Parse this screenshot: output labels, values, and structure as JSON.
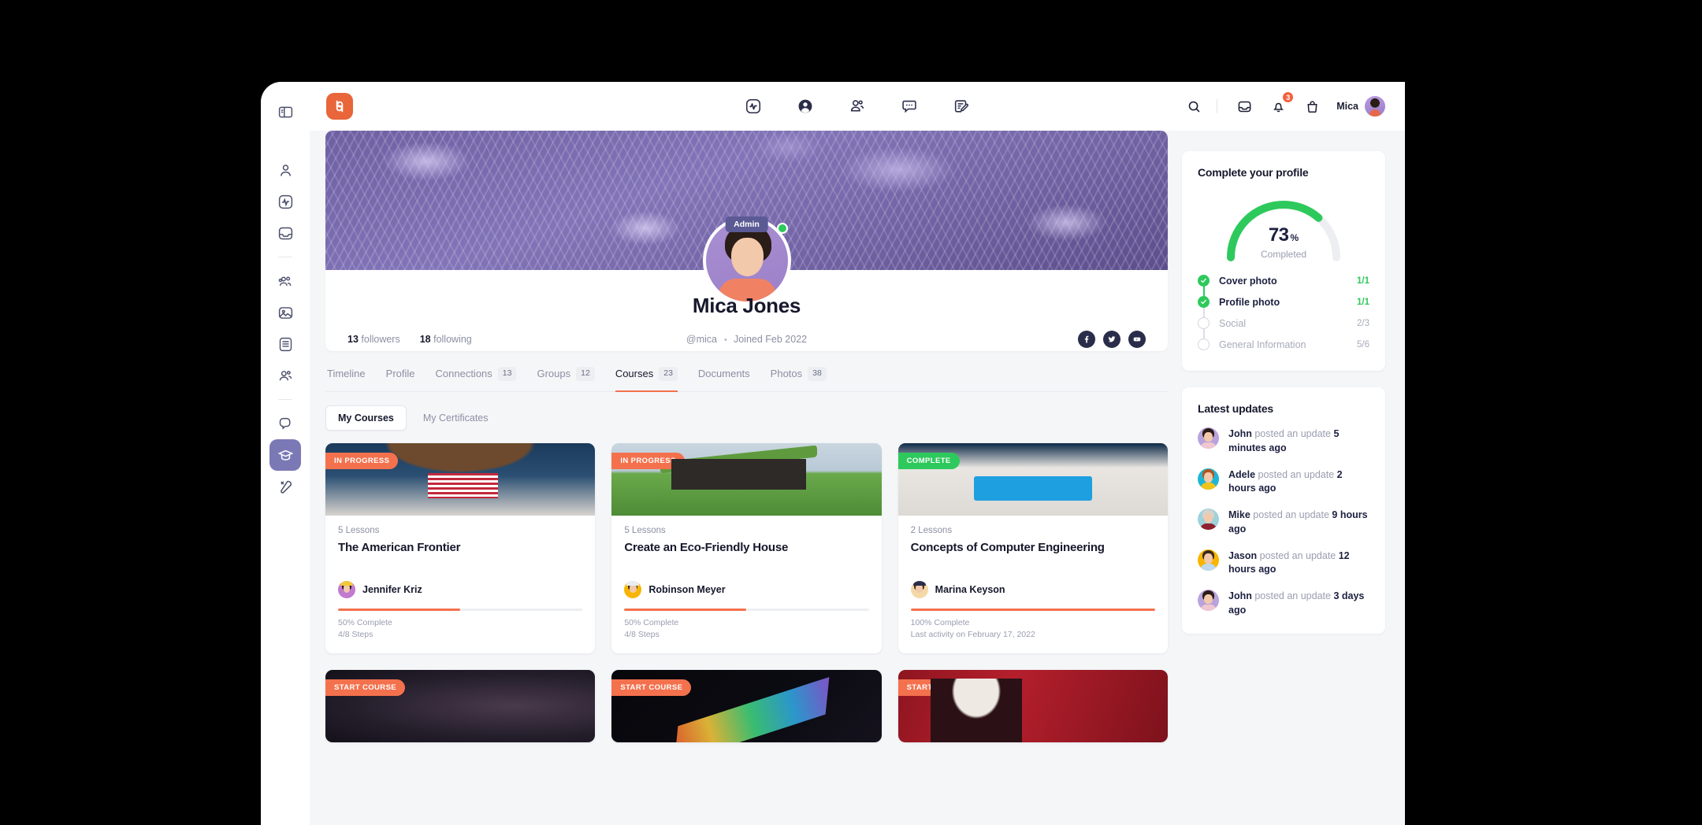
{
  "app": {
    "logo_name": "buddyboss-logo",
    "accent": "#f4714d",
    "logo_bg": "#e8663a",
    "green": "#2ec95c",
    "purple": "#5b5a95"
  },
  "rail": {
    "items": [
      {
        "icon": "person-icon",
        "label": "Profile",
        "active": false
      },
      {
        "icon": "activity-icon",
        "label": "Activity",
        "active": false
      },
      {
        "icon": "inbox-icon",
        "label": "Inbox",
        "active": false
      },
      {
        "icon": "groups-icon",
        "label": "Groups",
        "active": false
      },
      {
        "icon": "photos-icon",
        "label": "Photos",
        "active": false
      },
      {
        "icon": "list-icon",
        "label": "Documents",
        "active": false
      },
      {
        "icon": "members-icon",
        "label": "Members",
        "active": false
      },
      {
        "icon": "chat-icon",
        "label": "Messages",
        "active": false
      },
      {
        "icon": "graduation-cap-icon",
        "label": "Courses",
        "active": true
      },
      {
        "icon": "tools-icon",
        "label": "Tools",
        "active": false
      }
    ],
    "toggle_icon": "sidebar-toggle-icon"
  },
  "header": {
    "nav": [
      {
        "icon": "activity-icon",
        "label": "Activity"
      },
      {
        "icon": "profile-icon",
        "label": "Profile"
      },
      {
        "icon": "members-icon",
        "label": "Members"
      },
      {
        "icon": "messages-icon",
        "label": "Messages"
      },
      {
        "icon": "forums-icon",
        "label": "Forums"
      }
    ],
    "search_icon": "search-icon",
    "inbox_icon": "inbox-icon",
    "bell_icon": "bell-icon",
    "bell_count": "3",
    "cart_icon": "shopping-bag-icon",
    "user_name": "Mica",
    "avatar_name": "user-avatar"
  },
  "profile": {
    "cover_name": "cover-photo",
    "avatar_name": "profile-avatar",
    "online": true,
    "badge": "Admin",
    "name": "Mica Jones",
    "followers_count": "13",
    "followers_label": "followers",
    "following_count": "18",
    "following_label": "following",
    "handle": "@mica",
    "joined": "Joined Feb 2022",
    "social": [
      {
        "name": "facebook-icon"
      },
      {
        "name": "twitter-icon"
      },
      {
        "name": "youtube-icon"
      }
    ]
  },
  "tabs": [
    {
      "label": "Timeline",
      "count": null,
      "active": false
    },
    {
      "label": "Profile",
      "count": null,
      "active": false
    },
    {
      "label": "Connections",
      "count": "13",
      "active": false
    },
    {
      "label": "Groups",
      "count": "12",
      "active": false
    },
    {
      "label": "Courses",
      "count": "23",
      "active": true
    },
    {
      "label": "Documents",
      "count": null,
      "active": false
    },
    {
      "label": "Photos",
      "count": "38",
      "active": false
    }
  ],
  "subtabs": [
    {
      "label": "My Courses",
      "active": true
    },
    {
      "label": "My Certificates",
      "active": false
    }
  ],
  "courses": [
    {
      "badge": "IN PROGRESS",
      "badge_type": "progress",
      "image": "img-flag",
      "lessons": "5 Lessons",
      "title": "The American Frontier",
      "author": "Jennifer Kriz",
      "progress_pct": 50,
      "progress_text": "50% Complete",
      "steps_text": "4/8 Steps"
    },
    {
      "badge": "IN PROGRESS",
      "badge_type": "progress",
      "image": "img-house",
      "lessons": "5 Lessons",
      "title": "Create an Eco-Friendly House",
      "author": "Robinson Meyer",
      "progress_pct": 50,
      "progress_text": "50% Complete",
      "steps_text": "4/8 Steps"
    },
    {
      "badge": "COMPLETE",
      "badge_type": "complete",
      "image": "img-laptop",
      "lessons": "2 Lessons",
      "title": "Concepts of Computer Engineering",
      "author": "Marina Keyson",
      "progress_pct": 100,
      "progress_text": "100% Complete",
      "steps_text": "Last activity on February 17, 2022"
    }
  ],
  "courses_row2": [
    {
      "badge": "START COURSE",
      "badge_type": "start",
      "image": "img-space"
    },
    {
      "badge": "START COURSE",
      "badge_type": "start",
      "image": "img-prism"
    },
    {
      "badge": "START COURSE",
      "badge_type": "start",
      "image": "img-singer"
    }
  ],
  "complete_profile": {
    "title": "Complete your profile",
    "percent": "73",
    "percent_symbol": "%",
    "completed_label": "Completed",
    "gauge_value": 73,
    "items": [
      {
        "label": "Cover photo",
        "value": "1/1",
        "done": true
      },
      {
        "label": "Profile photo",
        "value": "1/1",
        "done": true
      },
      {
        "label": "Social",
        "value": "2/3",
        "done": false
      },
      {
        "label": "General Information",
        "value": "5/6",
        "done": false
      }
    ]
  },
  "latest_updates": {
    "title": "Latest updates",
    "items": [
      {
        "user": "John",
        "action": "posted an update",
        "time": "5 minutes ago",
        "hair": "#2a1c16",
        "shirt": "#f0c6d0",
        "bg": "#b9a3dd"
      },
      {
        "user": "Adele",
        "action": "posted an update",
        "time": "2 hours ago",
        "hair": "#b4531f",
        "shirt": "#f0c419",
        "bg": "#1fb6d4"
      },
      {
        "user": "Mike",
        "action": "posted an update",
        "time": "9 hours ago",
        "hair": "#d6d2cd",
        "shirt": "#8e2230",
        "bg": "#9ed2dc"
      },
      {
        "user": "Jason",
        "action": "posted an update",
        "time": "12 hours ago",
        "hair": "#3a2a1e",
        "shirt": "#bcd9ef",
        "bg": "#f7b500"
      },
      {
        "user": "John",
        "action": "posted an update",
        "time": "3 days ago",
        "hair": "#2a1c16",
        "shirt": "#f0c6d0",
        "bg": "#b9a3dd"
      }
    ]
  }
}
